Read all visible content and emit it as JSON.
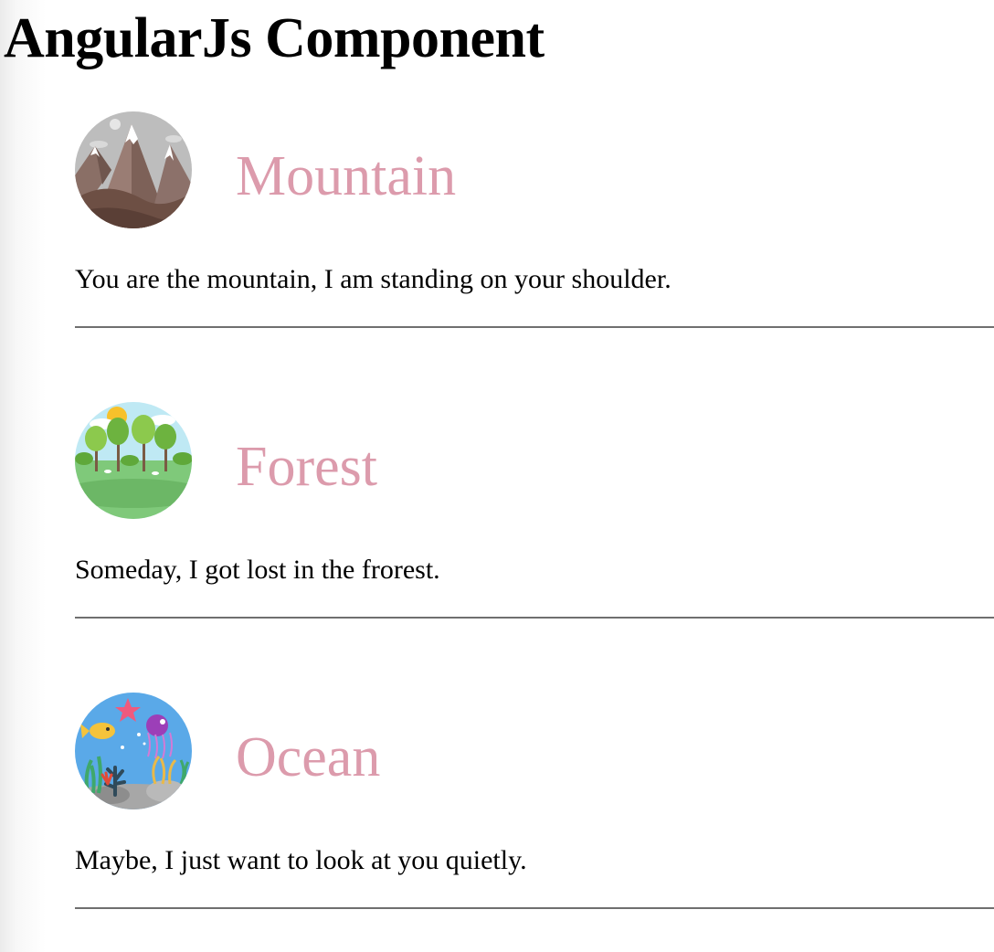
{
  "page": {
    "title": "AngularJs Component"
  },
  "cards": [
    {
      "icon": "mountain-icon",
      "title": "Mountain",
      "text": "You are the mountain, I am standing on your shoulder."
    },
    {
      "icon": "forest-icon",
      "title": "Forest",
      "text": "Someday, I got lost in the frorest."
    },
    {
      "icon": "ocean-icon",
      "title": "Ocean",
      "text": "Maybe, I just want to look at you quietly."
    }
  ],
  "colors": {
    "card_title": "#dc9bac",
    "divider": "#6f6f6f",
    "text": "#000000"
  }
}
